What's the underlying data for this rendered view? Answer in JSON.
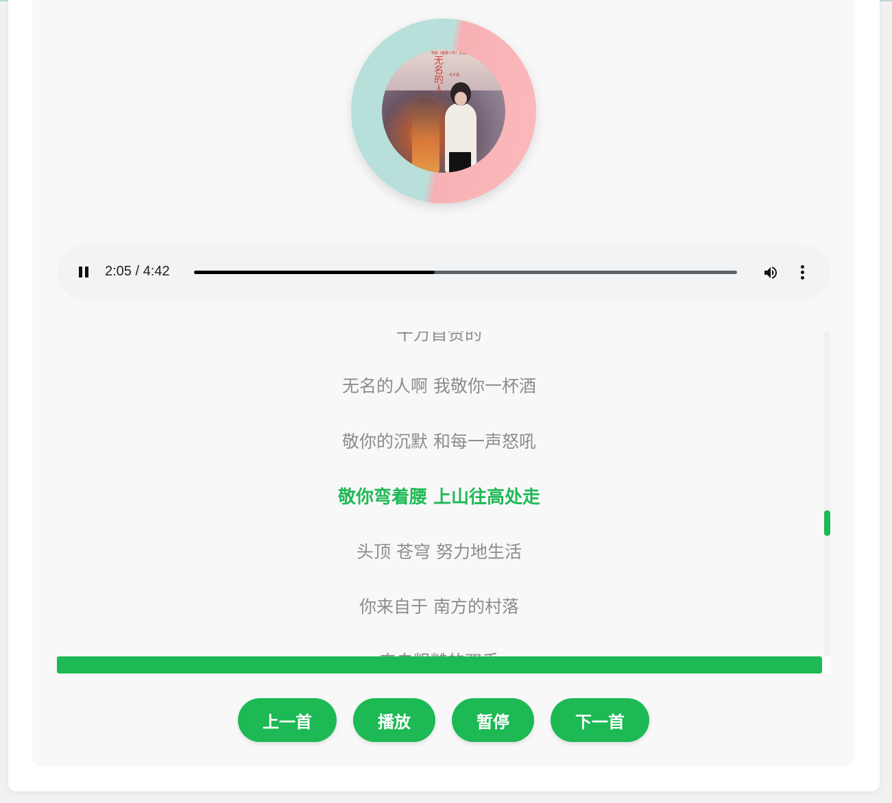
{
  "album": {
    "cover_title": "无名的人",
    "cover_tag": "电影《雄狮少年》主题曲",
    "cover_subtitle": "毛不易"
  },
  "player": {
    "state": "playing",
    "current_time": "2:05",
    "duration": "4:42",
    "time_display": "2:05 / 4:42",
    "progress_fraction": 0.443,
    "icons": [
      "pause-icon",
      "volume-icon",
      "more-options-icon"
    ]
  },
  "lyrics": {
    "lines": [
      "千万首赞的",
      "无名的人啊 我敬你一杯酒",
      "敬你的沉默 和每一声怒吼",
      "敬你弯着腰 上山往高处走",
      "头顶 苍穹 努力地生活",
      "你来自于 南方的村落",
      "来自粗糙的双手"
    ],
    "active_index": 3
  },
  "controls": {
    "prev": "上一首",
    "play": "播放",
    "pause": "暂停",
    "next": "下一首"
  },
  "colors": {
    "accent": "#1db954",
    "lyric_inactive": "#8c8c8c",
    "player_bg": "#f1f3f4"
  }
}
